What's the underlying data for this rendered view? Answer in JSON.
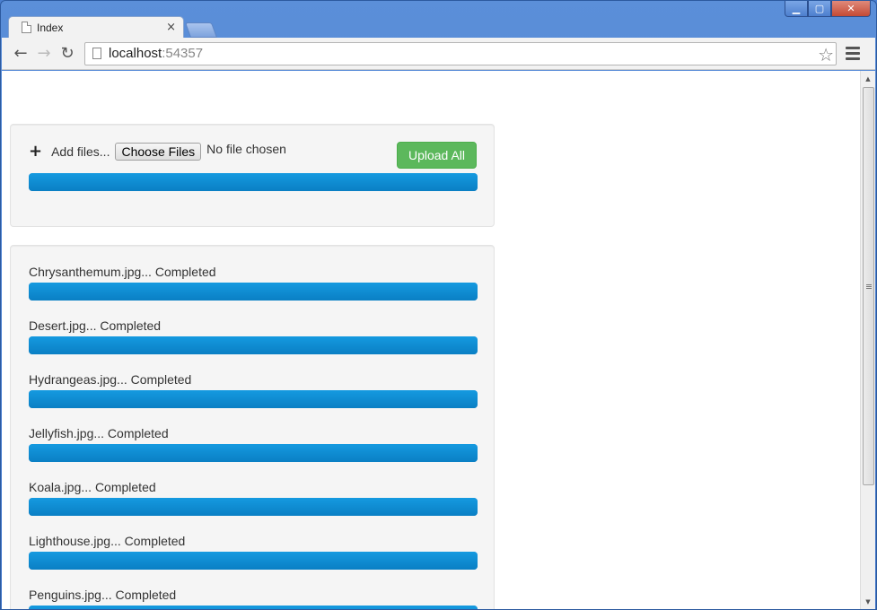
{
  "window": {
    "controls": {
      "minimize": "▁",
      "maximize": "▢",
      "close": "✕"
    }
  },
  "tabs": [
    {
      "title": "Index",
      "close_glyph": "×"
    }
  ],
  "toolbar": {
    "back_glyph": "←",
    "forward_glyph": "→",
    "reload_glyph": "↻",
    "url_host": "localhost",
    "url_port": ":54357",
    "star_glyph": "☆"
  },
  "upload_panel": {
    "plus_glyph": "+",
    "add_label": "Add files...",
    "choose_button": "Choose Files",
    "no_file_text": "No file chosen",
    "upload_all_label": "Upload All",
    "overall_progress": 1.0
  },
  "files": [
    {
      "label": "Chrysanthemum.jpg... Completed",
      "progress": 1.0
    },
    {
      "label": "Desert.jpg... Completed",
      "progress": 1.0
    },
    {
      "label": "Hydrangeas.jpg... Completed",
      "progress": 1.0
    },
    {
      "label": "Jellyfish.jpg... Completed",
      "progress": 1.0
    },
    {
      "label": "Koala.jpg... Completed",
      "progress": 1.0
    },
    {
      "label": "Lighthouse.jpg... Completed",
      "progress": 1.0
    },
    {
      "label": "Penguins.jpg... Completed",
      "progress": 1.0
    }
  ],
  "colors": {
    "progress_blue": "#0a7fc4",
    "upload_green": "#5cb85c",
    "well_background": "#f5f5f5"
  },
  "scrollbar": {
    "up_glyph": "▲",
    "down_glyph": "▼"
  }
}
